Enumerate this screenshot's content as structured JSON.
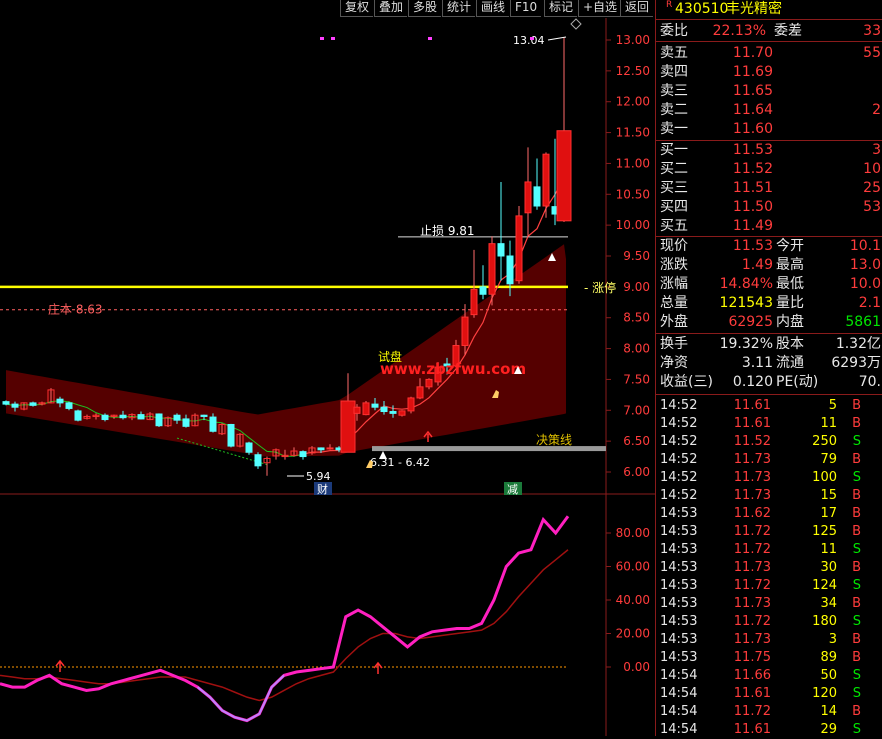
{
  "toolbar": {
    "buttons": [
      "复权",
      "叠加",
      "多股",
      "统计",
      "画线",
      "F10",
      "标记",
      "+自选",
      "返回"
    ]
  },
  "stock": {
    "code_prefix": "R",
    "code": "430510",
    "name": "丰光精密"
  },
  "quote": {
    "weibi_label": "委比",
    "weibi_value": "22.13%",
    "weicha_label": "委差",
    "weicha_value": "33",
    "asks": [
      {
        "label": "卖五",
        "price": "11.70",
        "vol": "55"
      },
      {
        "label": "卖四",
        "price": "11.69",
        "vol": ""
      },
      {
        "label": "卖三",
        "price": "11.65",
        "vol": ""
      },
      {
        "label": "卖二",
        "price": "11.64",
        "vol": "2"
      },
      {
        "label": "卖一",
        "price": "11.60",
        "vol": ""
      }
    ],
    "bids": [
      {
        "label": "买一",
        "price": "11.53",
        "vol": "3"
      },
      {
        "label": "买二",
        "price": "11.52",
        "vol": "10"
      },
      {
        "label": "买三",
        "price": "11.51",
        "vol": "25"
      },
      {
        "label": "买四",
        "price": "11.50",
        "vol": "53"
      },
      {
        "label": "买五",
        "price": "11.49",
        "vol": ""
      }
    ],
    "stats": [
      {
        "l1": "现价",
        "v1": "11.53",
        "l2": "今开",
        "v2": "10.1"
      },
      {
        "l1": "涨跌",
        "v1": "1.49",
        "l2": "最高",
        "v2": "13.0"
      },
      {
        "l1": "涨幅",
        "v1": "14.84%",
        "l2": "最低",
        "v2": "10.0"
      },
      {
        "l1": "总量",
        "v1": "121543",
        "l2": "量比",
        "v2": "2.1"
      },
      {
        "l1": "外盘",
        "v1": "62925",
        "l2": "内盘",
        "v2": "5861"
      }
    ],
    "stats2": [
      {
        "l1": "换手",
        "v1": "19.32%",
        "l2": "股本",
        "v2": "1.32亿"
      },
      {
        "l1": "净资",
        "v1": "3.11",
        "l2": "流通",
        "v2": "6293万"
      },
      {
        "l1": "收益(三)",
        "v1": "0.120",
        "l2": "PE(动)",
        "v2": "70."
      }
    ]
  },
  "ticks": [
    {
      "t": "14:52",
      "p": "11.61",
      "v": "5",
      "d": "B"
    },
    {
      "t": "14:52",
      "p": "11.61",
      "v": "11",
      "d": "B"
    },
    {
      "t": "14:52",
      "p": "11.52",
      "v": "250",
      "d": "S"
    },
    {
      "t": "14:52",
      "p": "11.73",
      "v": "79",
      "d": "B"
    },
    {
      "t": "14:52",
      "p": "11.73",
      "v": "100",
      "d": "S"
    },
    {
      "t": "14:52",
      "p": "11.73",
      "v": "15",
      "d": "B"
    },
    {
      "t": "14:53",
      "p": "11.62",
      "v": "17",
      "d": "B"
    },
    {
      "t": "14:53",
      "p": "11.72",
      "v": "125",
      "d": "B"
    },
    {
      "t": "14:53",
      "p": "11.72",
      "v": "11",
      "d": "S"
    },
    {
      "t": "14:53",
      "p": "11.73",
      "v": "30",
      "d": "B"
    },
    {
      "t": "14:53",
      "p": "11.72",
      "v": "124",
      "d": "S"
    },
    {
      "t": "14:53",
      "p": "11.73",
      "v": "34",
      "d": "B"
    },
    {
      "t": "14:53",
      "p": "11.72",
      "v": "180",
      "d": "S"
    },
    {
      "t": "14:53",
      "p": "11.73",
      "v": "3",
      "d": "B"
    },
    {
      "t": "14:53",
      "p": "11.75",
      "v": "89",
      "d": "B"
    },
    {
      "t": "14:54",
      "p": "11.66",
      "v": "50",
      "d": "S"
    },
    {
      "t": "14:54",
      "p": "11.61",
      "v": "120",
      "d": "S"
    },
    {
      "t": "14:54",
      "p": "11.72",
      "v": "14",
      "d": "B"
    },
    {
      "t": "14:54",
      "p": "11.61",
      "v": "29",
      "d": "S"
    }
  ],
  "chart_data": [
    {
      "type": "candlestick",
      "price_axis_ticks": [
        6.0,
        6.5,
        7.0,
        7.5,
        8.0,
        8.5,
        9.0,
        9.5,
        10.0,
        10.5,
        11.0,
        11.5,
        12.0,
        12.5,
        13.0
      ],
      "ylim": [
        5.8,
        13.15
      ],
      "candles": [
        [
          7.14,
          7.16,
          7.08,
          7.1
        ],
        [
          7.1,
          7.14,
          6.98,
          7.05
        ],
        [
          7.02,
          7.13,
          7.0,
          7.12
        ],
        [
          7.12,
          7.14,
          7.06,
          7.08
        ],
        [
          7.1,
          7.14,
          7.08,
          7.12
        ],
        [
          7.12,
          7.36,
          7.11,
          7.33
        ],
        [
          7.18,
          7.22,
          7.05,
          7.12
        ],
        [
          7.12,
          7.14,
          7.0,
          7.03
        ],
        [
          6.99,
          7.01,
          6.82,
          6.84
        ],
        [
          6.87,
          6.93,
          6.85,
          6.9
        ],
        [
          6.9,
          6.95,
          6.85,
          6.92
        ],
        [
          6.92,
          6.95,
          6.82,
          6.85
        ],
        [
          6.9,
          6.93,
          6.86,
          6.92
        ],
        [
          6.92,
          6.99,
          6.85,
          6.88
        ],
        [
          6.88,
          6.95,
          6.84,
          6.93
        ],
        [
          6.93,
          6.98,
          6.85,
          6.86
        ],
        [
          6.85,
          6.97,
          6.84,
          6.94
        ],
        [
          6.94,
          6.95,
          6.73,
          6.75
        ],
        [
          6.75,
          6.9,
          6.73,
          6.88
        ],
        [
          6.92,
          6.95,
          6.78,
          6.84
        ],
        [
          6.86,
          6.93,
          6.72,
          6.74
        ],
        [
          6.75,
          6.95,
          6.74,
          6.92
        ],
        [
          6.92,
          6.93,
          6.84,
          6.9
        ],
        [
          6.89,
          6.95,
          6.64,
          6.66
        ],
        [
          6.62,
          6.79,
          6.6,
          6.77
        ],
        [
          6.77,
          6.78,
          6.4,
          6.42
        ],
        [
          6.42,
          6.63,
          6.4,
          6.61
        ],
        [
          6.47,
          6.49,
          6.28,
          6.32
        ],
        [
          6.28,
          6.32,
          6.05,
          6.1
        ],
        [
          6.15,
          6.25,
          5.94,
          6.22
        ],
        [
          6.26,
          6.38,
          6.2,
          6.36
        ],
        [
          6.25,
          6.36,
          6.2,
          6.27
        ],
        [
          6.27,
          6.4,
          6.25,
          6.34
        ],
        [
          6.33,
          6.35,
          6.2,
          6.25
        ],
        [
          6.31,
          6.42,
          6.28,
          6.39
        ],
        [
          6.39,
          6.4,
          6.31,
          6.36
        ],
        [
          6.38,
          6.45,
          6.36,
          6.39
        ],
        [
          6.39,
          6.42,
          6.32,
          6.36
        ],
        [
          6.32,
          7.6,
          6.32,
          7.15
        ],
        [
          6.95,
          7.1,
          6.83,
          7.05
        ],
        [
          6.93,
          7.15,
          6.92,
          7.12
        ],
        [
          7.1,
          7.2,
          7.0,
          7.05
        ],
        [
          7.05,
          7.15,
          6.93,
          6.98
        ],
        [
          6.98,
          7.08,
          6.88,
          6.95
        ],
        [
          6.92,
          7.0,
          6.9,
          6.99
        ],
        [
          6.99,
          7.22,
          6.95,
          7.2
        ],
        [
          7.2,
          7.52,
          7.18,
          7.38
        ],
        [
          7.38,
          7.52,
          7.34,
          7.5
        ],
        [
          7.46,
          7.78,
          7.4,
          7.7
        ],
        [
          7.75,
          7.85,
          7.58,
          7.72
        ],
        [
          7.72,
          8.14,
          7.7,
          8.05
        ],
        [
          8.05,
          8.72,
          7.9,
          8.51
        ],
        [
          8.55,
          9.6,
          8.5,
          8.96
        ],
        [
          9.0,
          9.35,
          8.8,
          8.88
        ],
        [
          8.88,
          9.82,
          8.7,
          9.7
        ],
        [
          9.7,
          10.7,
          9.1,
          9.5
        ],
        [
          9.5,
          9.75,
          8.85,
          9.05
        ],
        [
          9.1,
          10.31,
          9.05,
          10.15
        ],
        [
          10.2,
          11.26,
          9.8,
          10.7
        ],
        [
          10.62,
          11.08,
          10.25,
          10.31
        ],
        [
          10.31,
          11.18,
          10.12,
          11.15
        ],
        [
          10.3,
          11.4,
          10.0,
          10.18
        ],
        [
          10.07,
          13.04,
          10.05,
          11.53
        ]
      ],
      "labels": {
        "high": "13.04",
        "low": "5.94",
        "range": "6.31 - 6.42",
        "stop_loss": "止损 9.81",
        "cost": "庄本 8.63",
        "limit": "涨停",
        "decision": "决策线",
        "try": "试盘",
        "fin": "财",
        "red": "减",
        "watermark": "www.zbzfwu.com"
      },
      "cost_value": 8.63,
      "stop_loss_value": 9.81,
      "limit_value": 9.0
    },
    {
      "type": "line",
      "y_axis_ticks": [
        0.0,
        20.0,
        40.0,
        60.0,
        80.0
      ],
      "ylim": [
        -35,
        96
      ],
      "series": [
        {
          "values": [
            -10,
            -12,
            -12,
            -8,
            -5,
            -10,
            -12,
            -14,
            -13,
            -10,
            -8,
            -6,
            -4,
            -2,
            -5,
            -8,
            -12,
            -18,
            -26,
            -30,
            -32,
            -28,
            -12,
            -5,
            -3,
            -2,
            -1,
            0,
            30,
            34,
            30,
            24,
            18,
            12,
            18,
            21,
            22,
            23,
            23,
            26,
            40,
            60,
            68,
            70,
            88,
            80,
            90
          ]
        },
        {
          "values": [
            -5,
            -6,
            -7,
            -7,
            -6,
            -7,
            -8,
            -9,
            -10,
            -10,
            -9,
            -8,
            -7,
            -6,
            -6,
            -6,
            -8,
            -10,
            -12,
            -15,
            -18,
            -20,
            -18,
            -14,
            -10,
            -7,
            -5,
            -3,
            5,
            12,
            17,
            20,
            20,
            18,
            17,
            18,
            19,
            20,
            21,
            22,
            26,
            33,
            42,
            50,
            58,
            64,
            70
          ]
        }
      ]
    }
  ]
}
